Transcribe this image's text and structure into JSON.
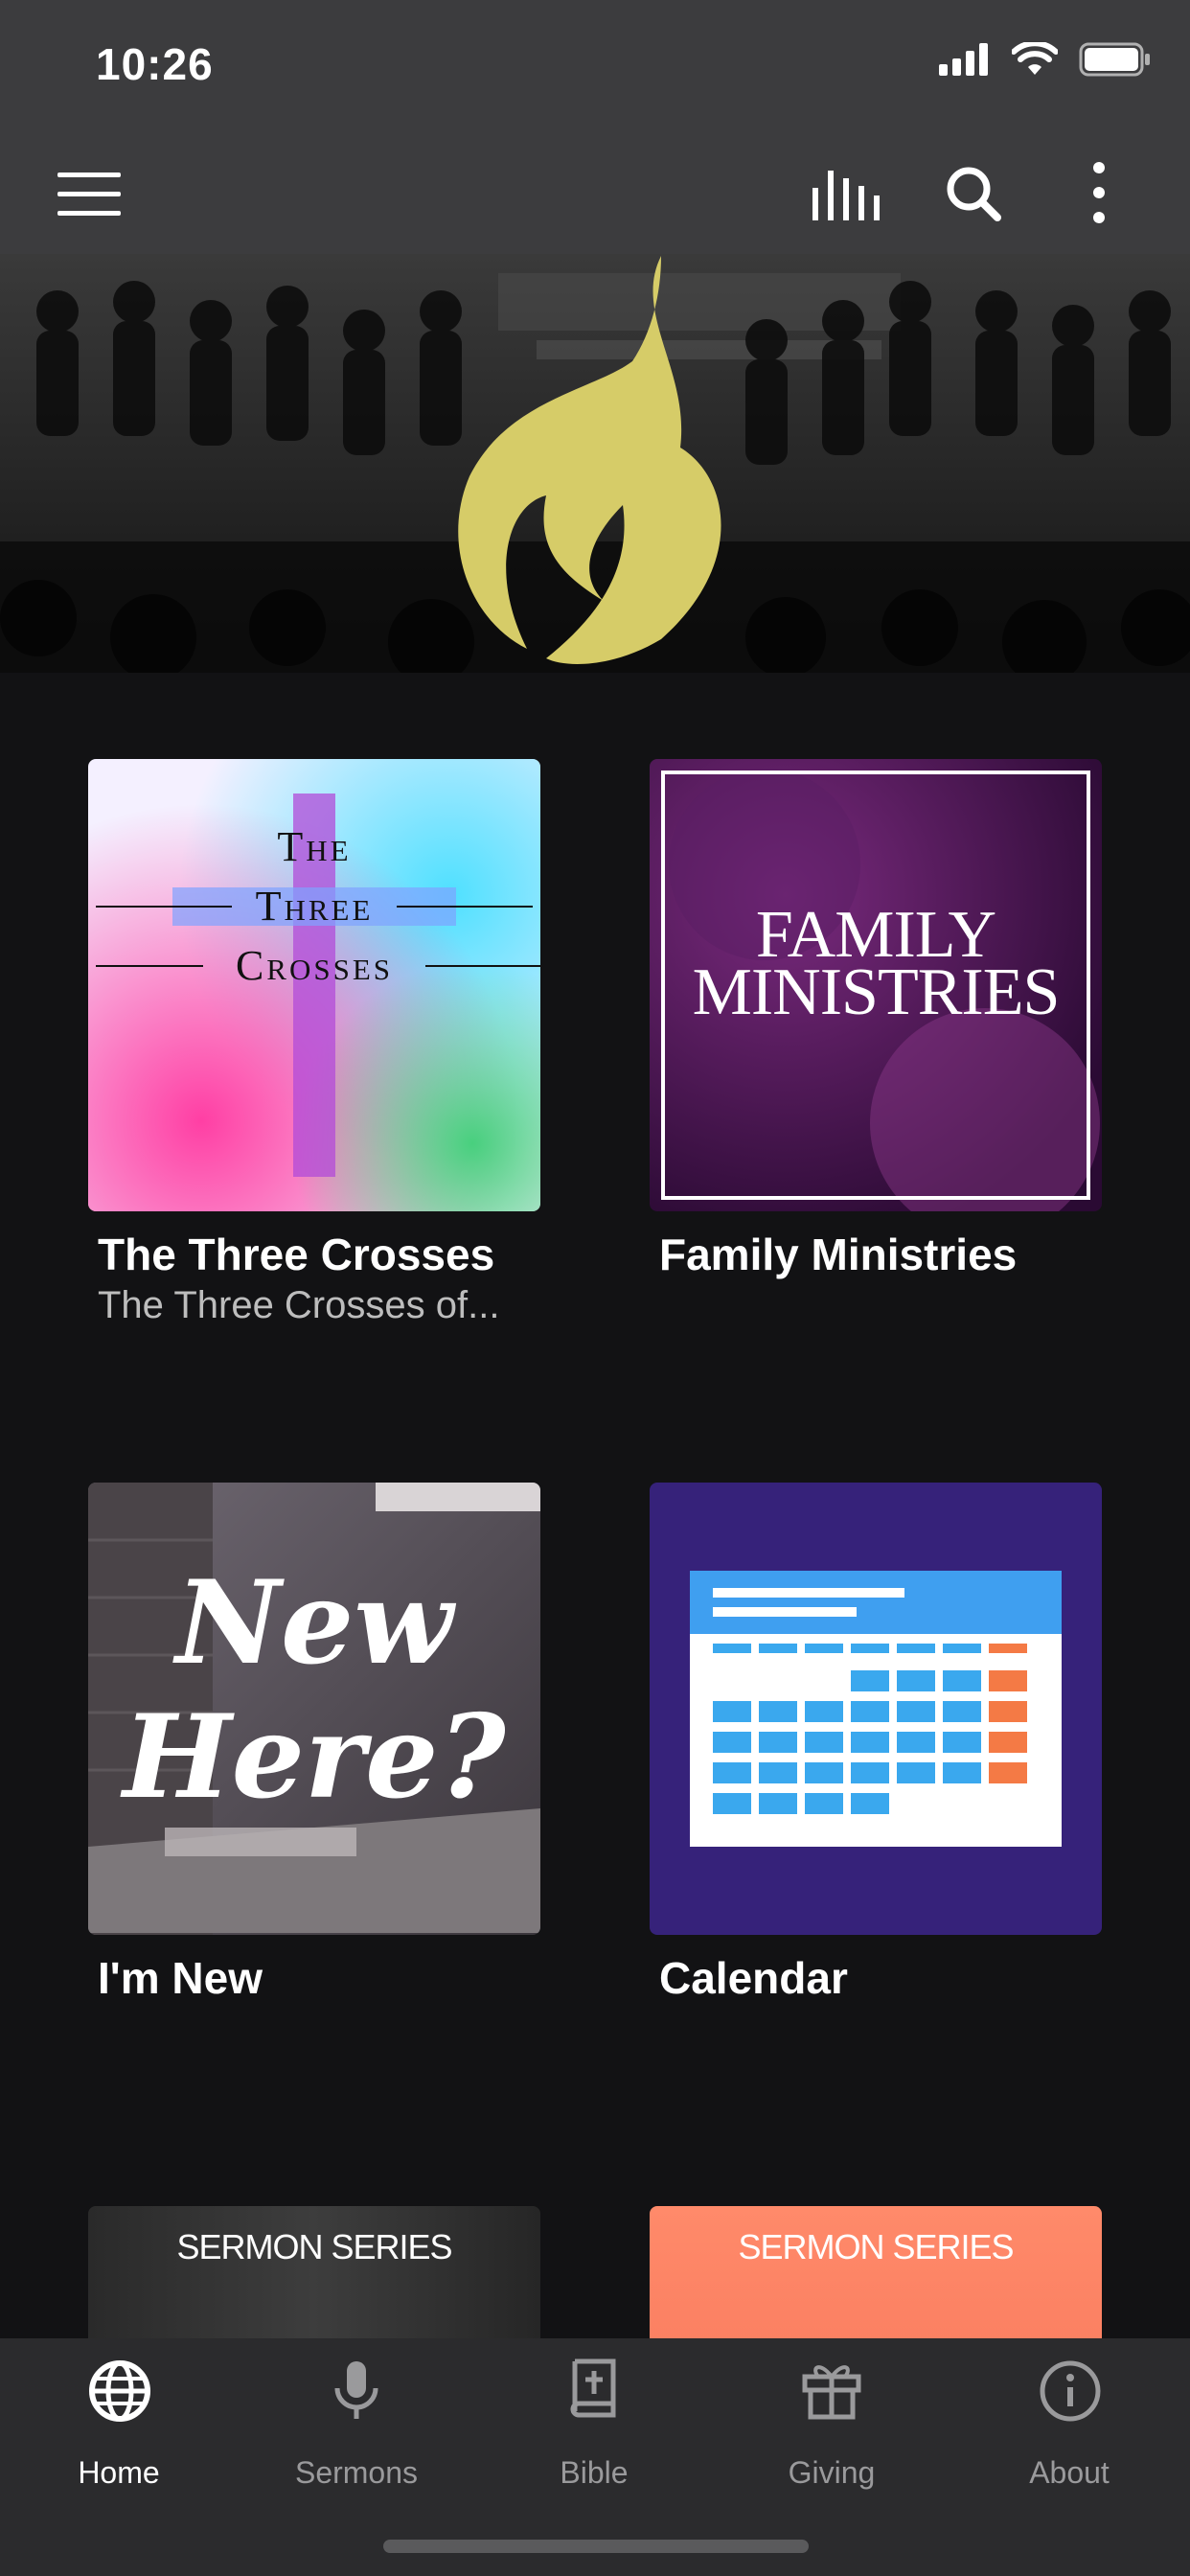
{
  "status_bar": {
    "time": "10:26"
  },
  "app_bar": {
    "menu_icon": "hamburger-menu-icon",
    "icons": [
      "audio-bars-icon",
      "search-icon",
      "more-vertical-icon"
    ]
  },
  "hero": {
    "logo_icon": "flame-logo-icon",
    "accent_color": "#d6cc68"
  },
  "cards": [
    {
      "title": "The Three Crosses",
      "subtitle": "The Three Crosses of...",
      "art_lines": [
        "The",
        "Three",
        "Crosses"
      ]
    },
    {
      "title": "Family Ministries",
      "art_lines": [
        "FAMILY",
        "MINISTRIES"
      ]
    },
    {
      "title": "I'm New",
      "art_lines": [
        "New",
        "Here?"
      ]
    },
    {
      "title": "Calendar"
    },
    {
      "art_text": "SERMON SERIES"
    },
    {
      "art_text": "SERMON SERIES"
    }
  ],
  "tabs": [
    {
      "label": "Home",
      "icon": "globe-icon",
      "active": true
    },
    {
      "label": "Sermons",
      "icon": "microphone-icon",
      "active": false
    },
    {
      "label": "Bible",
      "icon": "bible-icon",
      "active": false
    },
    {
      "label": "Giving",
      "icon": "gift-icon",
      "active": false
    },
    {
      "label": "About",
      "icon": "info-icon",
      "active": false
    }
  ],
  "colors": {
    "tab_active": "#ffffff",
    "tab_inactive": "#9a9a9c",
    "calendar_bg": "#36227a"
  }
}
